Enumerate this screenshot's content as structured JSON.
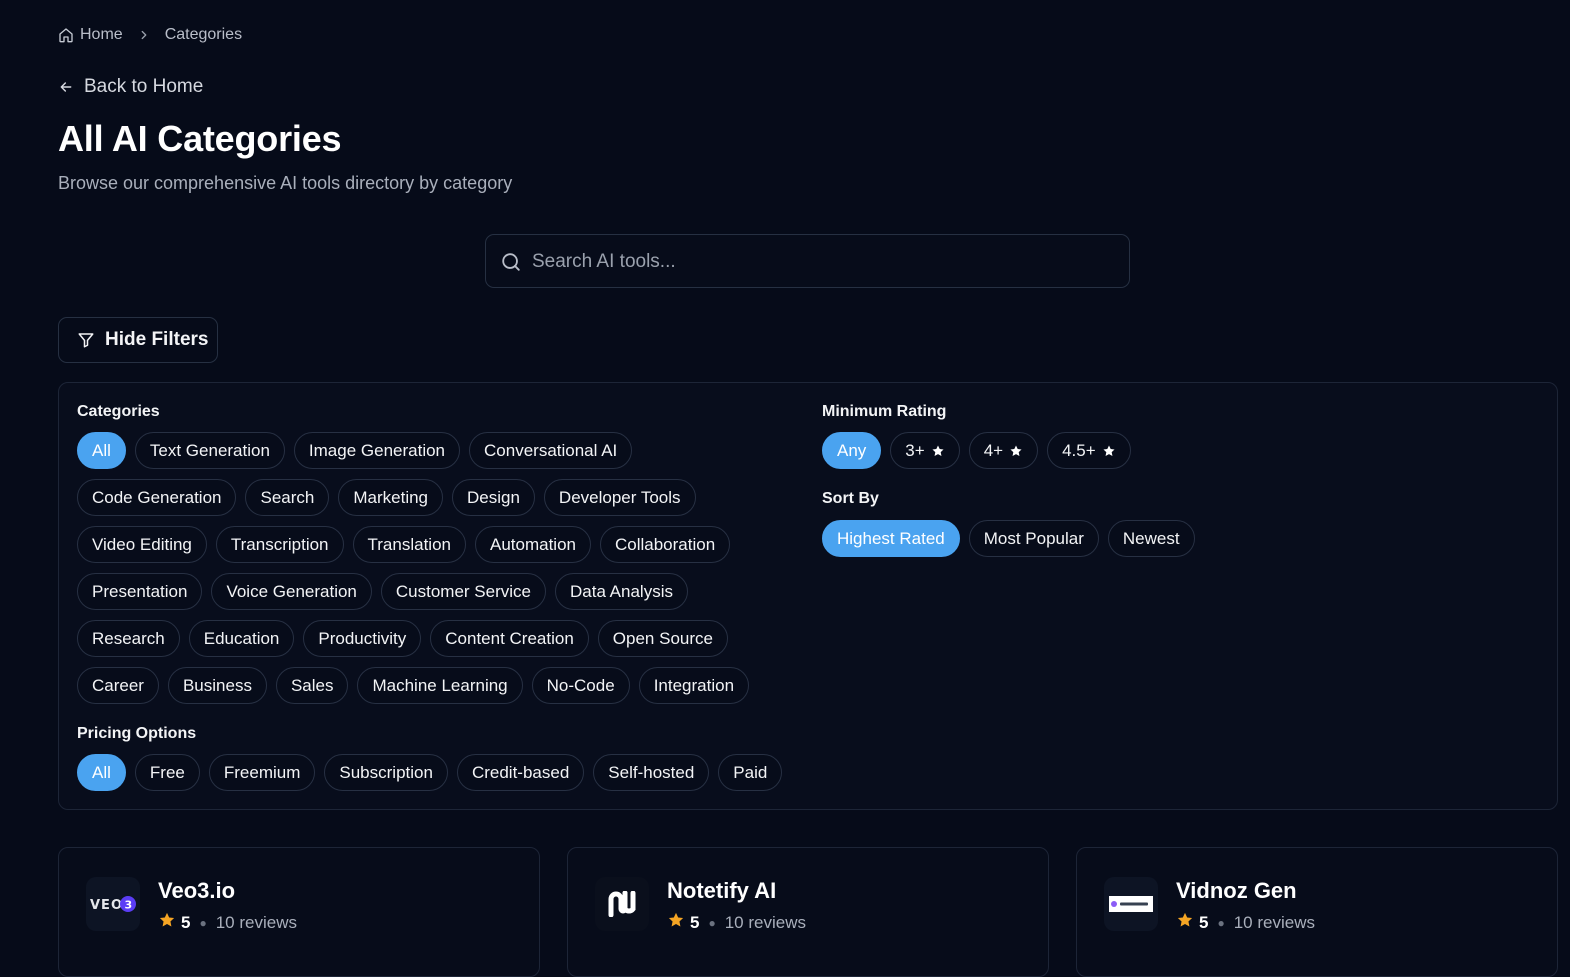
{
  "breadcrumb": {
    "home": "Home",
    "current": "Categories"
  },
  "back_link": "Back to Home",
  "page": {
    "title": "All AI Categories",
    "subtitle": "Browse our comprehensive AI tools directory by category"
  },
  "search": {
    "placeholder": "Search AI tools...",
    "value": ""
  },
  "filters_toggle": "Hide Filters",
  "filters": {
    "categories": {
      "title": "Categories",
      "selected": "All",
      "items": [
        "All",
        "Text Generation",
        "Image Generation",
        "Conversational AI",
        "Code Generation",
        "Search",
        "Marketing",
        "Design",
        "Developer Tools",
        "Video Editing",
        "Transcription",
        "Translation",
        "Automation",
        "Collaboration",
        "Presentation",
        "Voice Generation",
        "Customer Service",
        "Data Analysis",
        "Research",
        "Education",
        "Productivity",
        "Content Creation",
        "Open Source",
        "Career",
        "Business",
        "Sales",
        "Machine Learning",
        "No-Code",
        "Integration"
      ]
    },
    "pricing": {
      "title": "Pricing Options",
      "selected": "All",
      "items": [
        "All",
        "Free",
        "Freemium",
        "Subscription",
        "Credit-based",
        "Self-hosted",
        "Paid"
      ]
    },
    "rating": {
      "title": "Minimum Rating",
      "selected": "Any",
      "items": [
        {
          "label": "Any",
          "star": false
        },
        {
          "label": "3+",
          "star": true
        },
        {
          "label": "4+",
          "star": true
        },
        {
          "label": "4.5+",
          "star": true
        }
      ]
    },
    "sort": {
      "title": "Sort By",
      "selected": "Highest Rated",
      "items": [
        "Highest Rated",
        "Most Popular",
        "Newest"
      ]
    }
  },
  "tools": [
    {
      "name": "Veo3.io",
      "rating": "5",
      "reviews": "10 reviews",
      "logo": "veo3-logo"
    },
    {
      "name": "Notetify AI",
      "rating": "5",
      "reviews": "10 reviews",
      "logo": "notetify-logo"
    },
    {
      "name": "Vidnoz Gen",
      "rating": "5",
      "reviews": "10 reviews",
      "logo": "vidnoz-logo"
    }
  ],
  "colors": {
    "background": "#060b19",
    "accent": "#4aa3f0",
    "star": "#f5a524",
    "border": "#273043"
  }
}
